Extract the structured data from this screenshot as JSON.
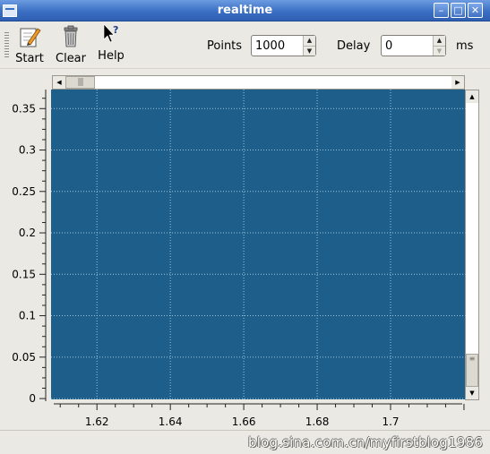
{
  "window": {
    "title": "realtime"
  },
  "toolbar": {
    "start_label": "Start",
    "clear_label": "Clear",
    "help_label": "Help",
    "points_label": "Points",
    "points_value": "1000",
    "delay_label": "Delay",
    "delay_value": "0",
    "delay_unit": "ms"
  },
  "watermark": "blog.sina.com.cn/myfirstblog1986",
  "colors": {
    "plot_background": "#1d5f8a",
    "grid": "#9fc3dc",
    "titlebar": "#3a6fc4"
  },
  "chart_data": {
    "type": "line",
    "series": [],
    "x_ticks": [
      "1.62",
      "1.64",
      "1.66",
      "1.68",
      "1.7"
    ],
    "y_ticks": [
      "0",
      "0.05",
      "0.1",
      "0.15",
      "0.2",
      "0.25",
      "0.3",
      "0.35"
    ],
    "xlim": [
      1.6075,
      1.7205
    ],
    "ylim": [
      -0.001,
      0.373
    ],
    "grid": true
  }
}
